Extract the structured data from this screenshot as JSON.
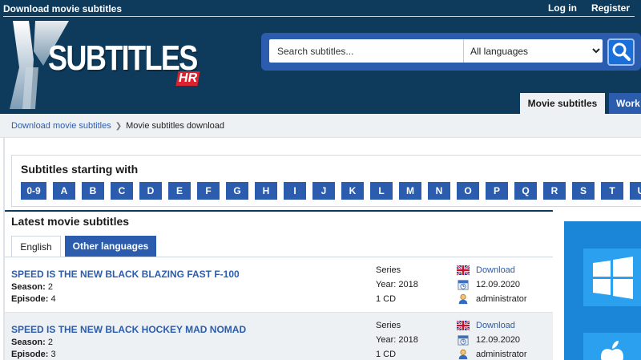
{
  "header": {
    "site_title": "Download movie subtitles",
    "login": "Log in",
    "register": "Register",
    "logo_text": "SUBTITLES",
    "logo_suffix": "HR"
  },
  "search": {
    "placeholder": "Search subtitles...",
    "language_selected": "All languages"
  },
  "nav_tabs": [
    {
      "label": "Movie subtitles"
    },
    {
      "label": "Work"
    }
  ],
  "breadcrumb": {
    "link": "Download movie subtitles",
    "current": "Movie subtitles download"
  },
  "letters": {
    "title": "Subtitles starting with",
    "items": [
      "0-9",
      "A",
      "B",
      "C",
      "D",
      "E",
      "F",
      "G",
      "H",
      "I",
      "J",
      "K",
      "L",
      "M",
      "N",
      "O",
      "P",
      "Q",
      "R",
      "S",
      "T",
      "U"
    ]
  },
  "latest": {
    "title": "Latest movie subtitles",
    "tab_english": "English",
    "tab_other": "Other languages",
    "season_label": "Season:",
    "episode_label": "Episode:",
    "rows": [
      {
        "title": "SPEED IS THE NEW BLACK BLAZING FAST F-100",
        "season": "2",
        "episode": "4",
        "type": "Series",
        "year": "Year: 2018",
        "cd": "1 CD",
        "download": "Download",
        "date": "12.09.2020",
        "user": "administrator"
      },
      {
        "title": "SPEED IS THE NEW BLACK HOCKEY MAD NOMAD",
        "season": "2",
        "episode": "3",
        "type": "Series",
        "year": "Year: 2018",
        "cd": "1 CD",
        "download": "Download",
        "date": "12.09.2020",
        "user": "administrator"
      }
    ]
  },
  "icons": {
    "flag": "uk-flag-icon",
    "calendar": "calendar-icon",
    "user": "user-icon",
    "search": "search-icon",
    "windows": "windows-logo-icon",
    "apple": "apple-logo-icon"
  },
  "colors": {
    "header_bg": "#0e3b5c",
    "accent": "#2b5cad",
    "link": "#2b5cad",
    "ad_bg": "#1b86d8"
  }
}
